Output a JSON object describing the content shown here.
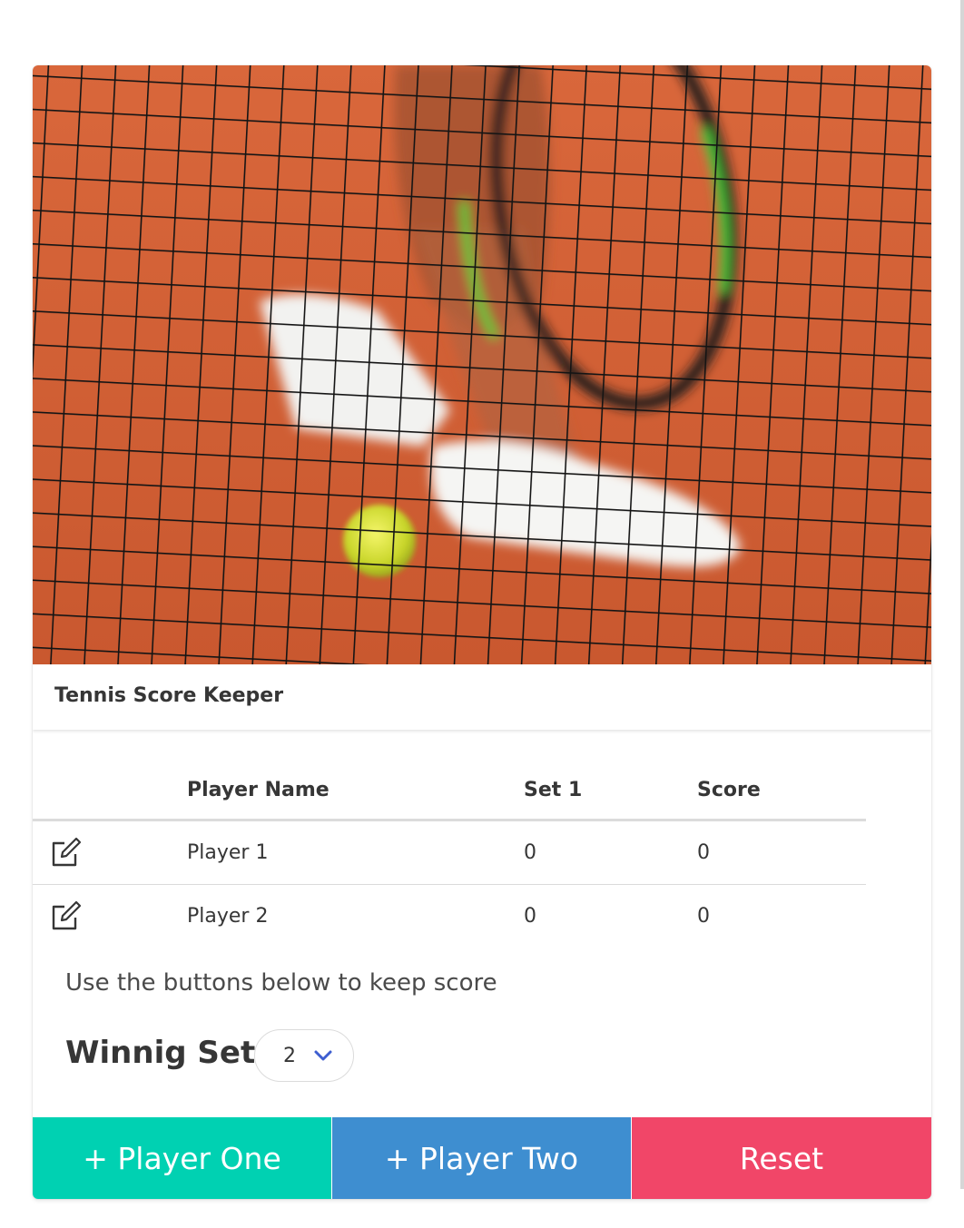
{
  "card": {
    "title": "Tennis Score Keeper",
    "image_subject": "tennis-net-racket-ball-photo"
  },
  "table": {
    "headers": {
      "icon": "",
      "name": "Player Name",
      "set1": "Set 1",
      "score": "Score"
    },
    "rows": [
      {
        "name": "Player 1",
        "set1": "0",
        "score": "0"
      },
      {
        "name": "Player 2",
        "set1": "0",
        "score": "0"
      }
    ]
  },
  "hint": "Use the buttons below to keep score",
  "winning_sets": {
    "label": "Winnig Sets",
    "value": "2"
  },
  "buttons": {
    "player_one": "+ Player One",
    "player_two": "+ Player Two",
    "reset": "Reset"
  },
  "colors": {
    "player_one": "#00d1b2",
    "player_two": "#3e8ed0",
    "reset": "#f14668",
    "chevron": "#3e5ed0"
  }
}
